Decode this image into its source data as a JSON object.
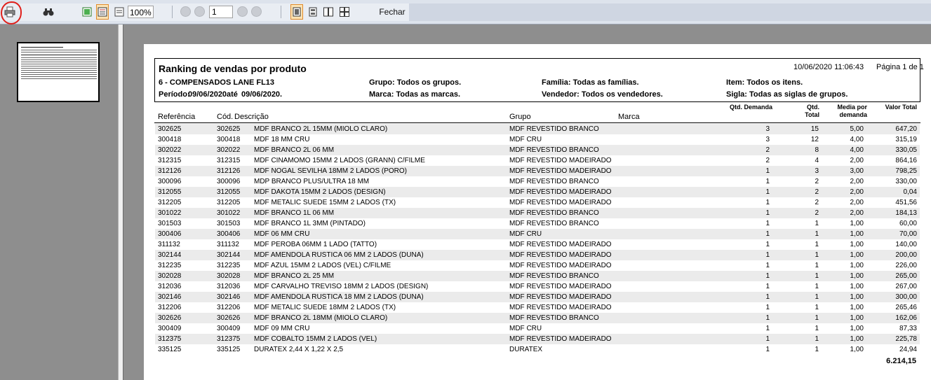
{
  "toolbar": {
    "zoom": "100%",
    "page_input": "1",
    "close_label": "Fechar"
  },
  "report": {
    "title": "Ranking de vendas por produto",
    "datetime": "10/06/2020 11:06:43",
    "page": "Página 1 de 1",
    "company": "6 - COMPENSADOS LANE FL13",
    "period_label": "Período:",
    "period_from": "09/06/2020",
    "period_until_label": "até",
    "period_to": "09/06/2020.",
    "grupo": "Grupo: Todos os grupos.",
    "marca": "Marca: Todas as marcas.",
    "familia": "Família: Todas as famílias.",
    "vendedor": "Vendedor: Todos os vendedores.",
    "item": "Item: Todos os itens.",
    "sigla": "Sigla: Todas as siglas de grupos.",
    "columns": {
      "referencia": "Referência",
      "cod": "Cód.",
      "descricao": "Descrição",
      "grupo": "Grupo",
      "marca": "Marca",
      "qtd_demanda": "Qtd. Demanda",
      "qtd_total_1": "Qtd.",
      "qtd_total_2": "Total",
      "media_1": "Media por",
      "media_2": "demanda",
      "valor_total": "Valor Total"
    },
    "rows": [
      {
        "ref": "302625",
        "cod": "302625",
        "desc": "MDF BRANCO 2L 15MM (MIOLO CLARO)",
        "grupo": "MDF REVESTIDO BRANCO",
        "dem": "3",
        "tot": "15",
        "med": "5,00",
        "val": "647,20"
      },
      {
        "ref": "300418",
        "cod": "300418",
        "desc": "MDF 18 MM CRU",
        "grupo": "MDF CRU",
        "dem": "3",
        "tot": "12",
        "med": "4,00",
        "val": "315,19"
      },
      {
        "ref": "302022",
        "cod": "302022",
        "desc": "MDF BRANCO 2L 06 MM",
        "grupo": "MDF REVESTIDO BRANCO",
        "dem": "2",
        "tot": "8",
        "med": "4,00",
        "val": "330,05"
      },
      {
        "ref": "312315",
        "cod": "312315",
        "desc": "MDF CINAMOMO 15MM 2 LADOS (GRANN) C/FILME",
        "grupo": "MDF REVESTIDO MADEIRADO  BI",
        "dem": "2",
        "tot": "4",
        "med": "2,00",
        "val": "864,16"
      },
      {
        "ref": "312126",
        "cod": "312126",
        "desc": "MDF NOGAL SEVILHA 18MM 2 LADOS (PORO)",
        "grupo": "MDF REVESTIDO MADEIRADO  BI",
        "dem": "1",
        "tot": "3",
        "med": "3,00",
        "val": "798,25"
      },
      {
        "ref": "300096",
        "cod": "300096",
        "desc": "MDP BRANCO PLUS/ULTRA 18 MM",
        "grupo": "MDF REVESTIDO BRANCO",
        "dem": "1",
        "tot": "2",
        "med": "2,00",
        "val": "330,00"
      },
      {
        "ref": "312055",
        "cod": "312055",
        "desc": "MDF DAKOTA 15MM 2 LADOS (DESIGN)",
        "grupo": "MDF REVESTIDO MADEIRADO  BI",
        "dem": "1",
        "tot": "2",
        "med": "2,00",
        "val": "0,04"
      },
      {
        "ref": "312205",
        "cod": "312205",
        "desc": "MDF METALIC SUEDE 15MM 2 LADOS (TX)",
        "grupo": "MDF REVESTIDO MADEIRADO  BI",
        "dem": "1",
        "tot": "2",
        "med": "2,00",
        "val": "451,56"
      },
      {
        "ref": "301022",
        "cod": "301022",
        "desc": "MDF BRANCO 1L 06 MM",
        "grupo": "MDF REVESTIDO BRANCO",
        "dem": "1",
        "tot": "2",
        "med": "2,00",
        "val": "184,13"
      },
      {
        "ref": "301503",
        "cod": "301503",
        "desc": "MDF BRANCO 1L 3MM (PINTADO)",
        "grupo": "MDF REVESTIDO BRANCO",
        "dem": "1",
        "tot": "1",
        "med": "1,00",
        "val": "60,00"
      },
      {
        "ref": "300406",
        "cod": "300406",
        "desc": "MDF 06 MM CRU",
        "grupo": "MDF CRU",
        "dem": "1",
        "tot": "1",
        "med": "1,00",
        "val": "70,00"
      },
      {
        "ref": "311132",
        "cod": "311132",
        "desc": "MDF PEROBA 06MM 1 LADO (TATTO)",
        "grupo": "MDF REVESTIDO MADEIRADO  BI",
        "dem": "1",
        "tot": "1",
        "med": "1,00",
        "val": "140,00"
      },
      {
        "ref": "302144",
        "cod": "302144",
        "desc": "MDF AMENDOLA RUSTICA 06 MM 2 LADOS (DUNA)",
        "grupo": "MDF REVESTIDO MADEIRADO  D",
        "dem": "1",
        "tot": "1",
        "med": "1,00",
        "val": "200,00"
      },
      {
        "ref": "312235",
        "cod": "312235",
        "desc": "MDF AZUL 15MM 2 LADOS (VEL) C/FILME",
        "grupo": "MDF REVESTIDO MADEIRADO  BI",
        "dem": "1",
        "tot": "1",
        "med": "1,00",
        "val": "226,00"
      },
      {
        "ref": "302028",
        "cod": "302028",
        "desc": "MDF BRANCO 2L 25 MM",
        "grupo": "MDF REVESTIDO BRANCO",
        "dem": "1",
        "tot": "1",
        "med": "1,00",
        "val": "265,00"
      },
      {
        "ref": "312036",
        "cod": "312036",
        "desc": "MDF CARVALHO TREVISO 18MM 2 LADOS (DESIGN)",
        "grupo": "MDF REVESTIDO MADEIRADO  BI",
        "dem": "1",
        "tot": "1",
        "med": "1,00",
        "val": "267,00"
      },
      {
        "ref": "302146",
        "cod": "302146",
        "desc": "MDF AMENDOLA RUSTICA 18 MM 2 LADOS (DUNA)",
        "grupo": "MDF REVESTIDO MADEIRADO  D",
        "dem": "1",
        "tot": "1",
        "med": "1,00",
        "val": "300,00"
      },
      {
        "ref": "312206",
        "cod": "312206",
        "desc": "MDF METALIC SUEDE 18MM 2 LADOS (TX)",
        "grupo": "MDF REVESTIDO MADEIRADO  BI",
        "dem": "1",
        "tot": "1",
        "med": "1,00",
        "val": "265,46"
      },
      {
        "ref": "302626",
        "cod": "302626",
        "desc": "MDF BRANCO 2L 18MM (MIOLO CLARO)",
        "grupo": "MDF REVESTIDO BRANCO",
        "dem": "1",
        "tot": "1",
        "med": "1,00",
        "val": "162,06"
      },
      {
        "ref": "300409",
        "cod": "300409",
        "desc": "MDF 09 MM CRU",
        "grupo": "MDF CRU",
        "dem": "1",
        "tot": "1",
        "med": "1,00",
        "val": "87,33"
      },
      {
        "ref": "312375",
        "cod": "312375",
        "desc": "MDF COBALTO 15MM 2 LADOS (VEL)",
        "grupo": "MDF REVESTIDO MADEIRADO  BI",
        "dem": "1",
        "tot": "1",
        "med": "1,00",
        "val": "225,78"
      },
      {
        "ref": "335125",
        "cod": "335125",
        "desc": "DURATEX 2,44 X 1,22 X 2,5",
        "grupo": "DURATEX",
        "dem": "1",
        "tot": "1",
        "med": "1,00",
        "val": "24,94"
      }
    ],
    "grand_total": "6.214,15"
  }
}
